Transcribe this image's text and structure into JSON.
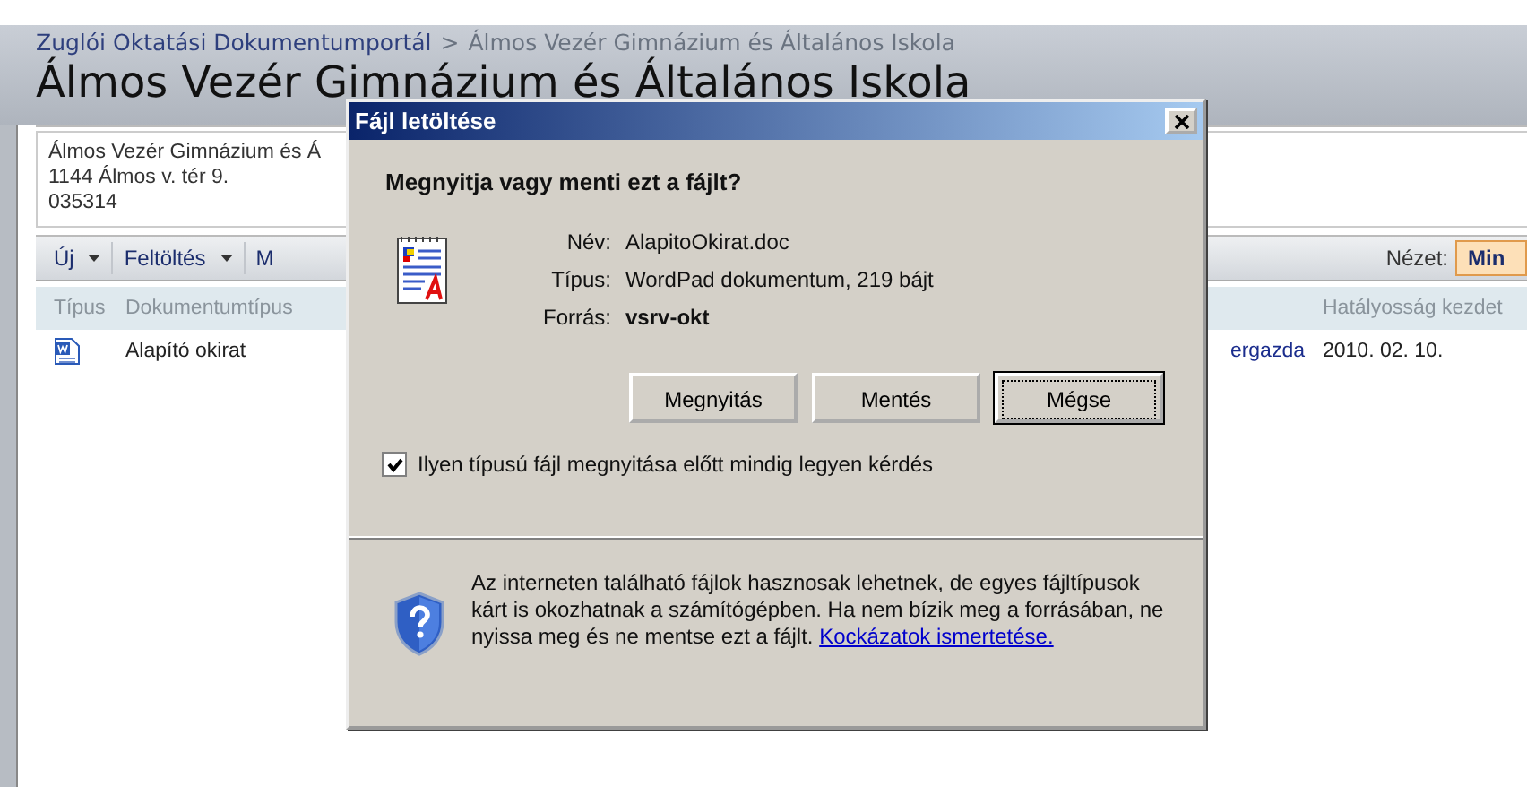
{
  "breadcrumb": {
    "link": "Zuglói Oktatási Dokumentumportál",
    "separator": ">",
    "current": "Álmos Vezér Gimnázium és Általános Iskola"
  },
  "page_title": "Álmos Vezér Gimnázium és Általános Iskola",
  "address_lines": [
    "Álmos Vezér Gimnázium és Á",
    "1144 Álmos v. tér 9.",
    "035314"
  ],
  "toolbar": {
    "items": [
      {
        "label": "Új",
        "dropdown": true
      },
      {
        "label": "Feltöltés",
        "dropdown": true
      },
      {
        "label": "M",
        "dropdown": false
      }
    ],
    "view_label": "Nézet:",
    "view_value": "Min"
  },
  "columns": [
    "Típus",
    "Dokumentumtípus",
    "Hatályosság kezdet"
  ],
  "rows": [
    {
      "document_type": "Alapító okirat",
      "column_3": "ergazda",
      "effective_date": "2010. 02. 10."
    }
  ],
  "dialog": {
    "title": "Fájl letöltése",
    "question": "Megnyitja vagy menti ezt a fájlt?",
    "fields": [
      {
        "label": "Név:",
        "value": "AlapitoOkirat.doc",
        "bold": false
      },
      {
        "label": "Típus:",
        "value": "WordPad dokumentum, 219 bájt",
        "bold": false
      },
      {
        "label": "Forrás:",
        "value": "vsrv-okt",
        "bold": true
      }
    ],
    "buttons": [
      {
        "label": "Megnyitás",
        "default": false
      },
      {
        "label": "Mentés",
        "default": false
      },
      {
        "label": "Mégse",
        "default": true
      }
    ],
    "checkbox": {
      "label": "Ilyen típusú fájl megnyitása előtt mindig legyen kérdés",
      "checked": true
    },
    "warning": {
      "text": "Az interneten található fájlok hasznosak lehetnek, de egyes fájltípusok kárt is okozhatnak a számítógépben. Ha nem bízik meg a forrásában, ne nyissa meg és ne mentse ezt a fájlt.",
      "link": "Kockázatok ismertetése."
    }
  }
}
